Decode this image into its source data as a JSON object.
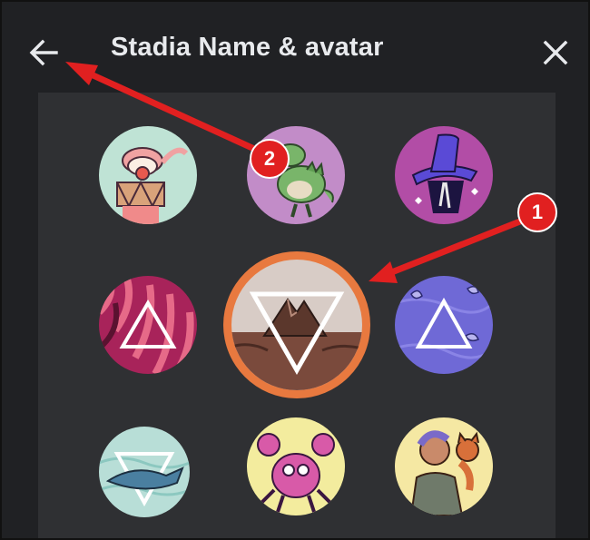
{
  "header": {
    "title": "Stadia Name & avatar",
    "back_icon": "arrow-left-icon",
    "close_icon": "close-icon"
  },
  "avatars": [
    {
      "name": "clown-with-drum",
      "bg": "#bfe3d5"
    },
    {
      "name": "green-dinosaur",
      "bg": "#c28cc8"
    },
    {
      "name": "wizard-hat",
      "bg": "#b24da6"
    },
    {
      "name": "pink-flames-triangle",
      "bg": "#a8235a"
    },
    {
      "name": "mountain-triangle",
      "bg": "#d8ccc6",
      "selected": true
    },
    {
      "name": "blue-leaves-triangle",
      "bg": "#6f69d6"
    },
    {
      "name": "whale-triangle",
      "bg": "#b8ded7"
    },
    {
      "name": "pink-crab",
      "bg": "#f3ec9e"
    },
    {
      "name": "person-with-cat",
      "bg": "#f5e8a3"
    }
  ],
  "annotations": [
    {
      "label": "1"
    },
    {
      "label": "2"
    }
  ],
  "colors": {
    "background": "#202124",
    "panel": "#2f3033",
    "selected_ring": "#e8793f",
    "annotation_red": "#e12020"
  }
}
